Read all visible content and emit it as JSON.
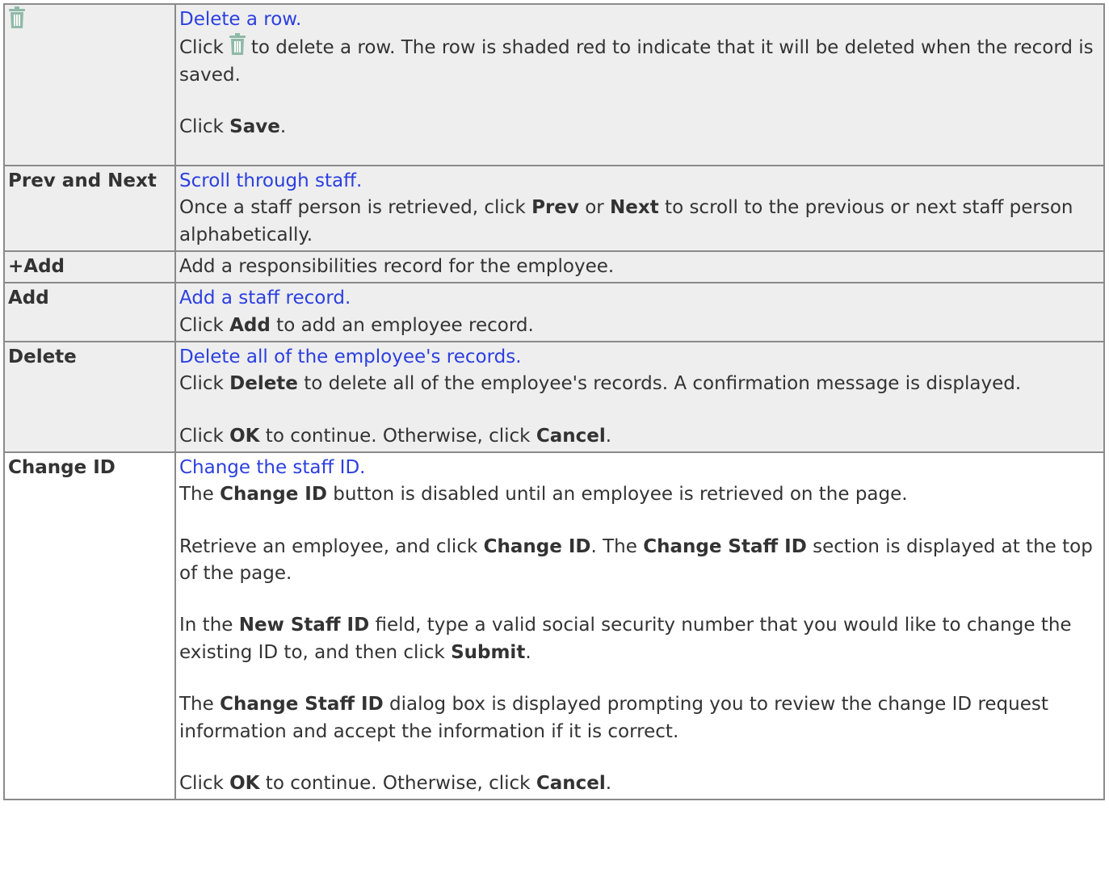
{
  "rows": {
    "delete_row": {
      "icon": "trash-icon",
      "link": "Delete a row.",
      "p1_pre": "Click",
      "p1_post": "to delete a row. The row is shaded red to indicate that it will be deleted when the record is saved.",
      "p2_pre": "Click ",
      "p2_bold": "Save",
      "p2_post": "."
    },
    "prev_next": {
      "label": "Prev and Next",
      "link": "Scroll through staff.",
      "p1_pre": "Once a staff person is retrieved, click ",
      "p1_b1": "Prev",
      "p1_mid": " or ",
      "p1_b2": "Next",
      "p1_post": " to scroll to the previous or next staff person alphabetically."
    },
    "plus_add": {
      "label": "+Add",
      "text": "Add a responsibilities record for the employee."
    },
    "add": {
      "label": "Add",
      "link": "Add a staff record.",
      "p1_pre": "Click ",
      "p1_bold": "Add",
      "p1_post": " to add an employee record."
    },
    "delete": {
      "label": "Delete",
      "link": "Delete all of the employee's records.",
      "p1_pre": "Click ",
      "p1_bold": "Delete",
      "p1_post": " to delete all of the employee's records. A confirmation message is displayed.",
      "p2_pre": "Click ",
      "p2_b1": "OK",
      "p2_mid": " to continue. Otherwise, click ",
      "p2_b2": "Cancel",
      "p2_post": "."
    },
    "change_id": {
      "label": "Change ID",
      "link": "Change the staff ID.",
      "p1_pre": "The ",
      "p1_bold": "Change ID",
      "p1_post": " button is disabled until an employee is retrieved on the page.",
      "p2_pre": "Retrieve an employee, and click ",
      "p2_b1": "Change ID",
      "p2_mid": ". The ",
      "p2_b2": "Change Staff ID",
      "p2_post": " section is displayed at the top of the page.",
      "p3_pre": "In the ",
      "p3_b1": "New Staff ID",
      "p3_mid": " field, type a valid social security number that you would like to change the existing ID to, and then click ",
      "p3_b2": "Submit",
      "p3_post": ".",
      "p4_pre": "The ",
      "p4_bold": "Change Staff ID",
      "p4_post": " dialog box is displayed prompting you to review the change ID request information and accept the information if it is correct.",
      "p5_pre": "Click ",
      "p5_b1": "OK",
      "p5_mid": " to continue. Otherwise, click ",
      "p5_b2": "Cancel",
      "p5_post": "."
    }
  },
  "colors": {
    "link": "#2b3fe0",
    "shaded_bg": "#eeeeee",
    "border": "#8a8a8a",
    "icon": "#8fb9a8"
  }
}
